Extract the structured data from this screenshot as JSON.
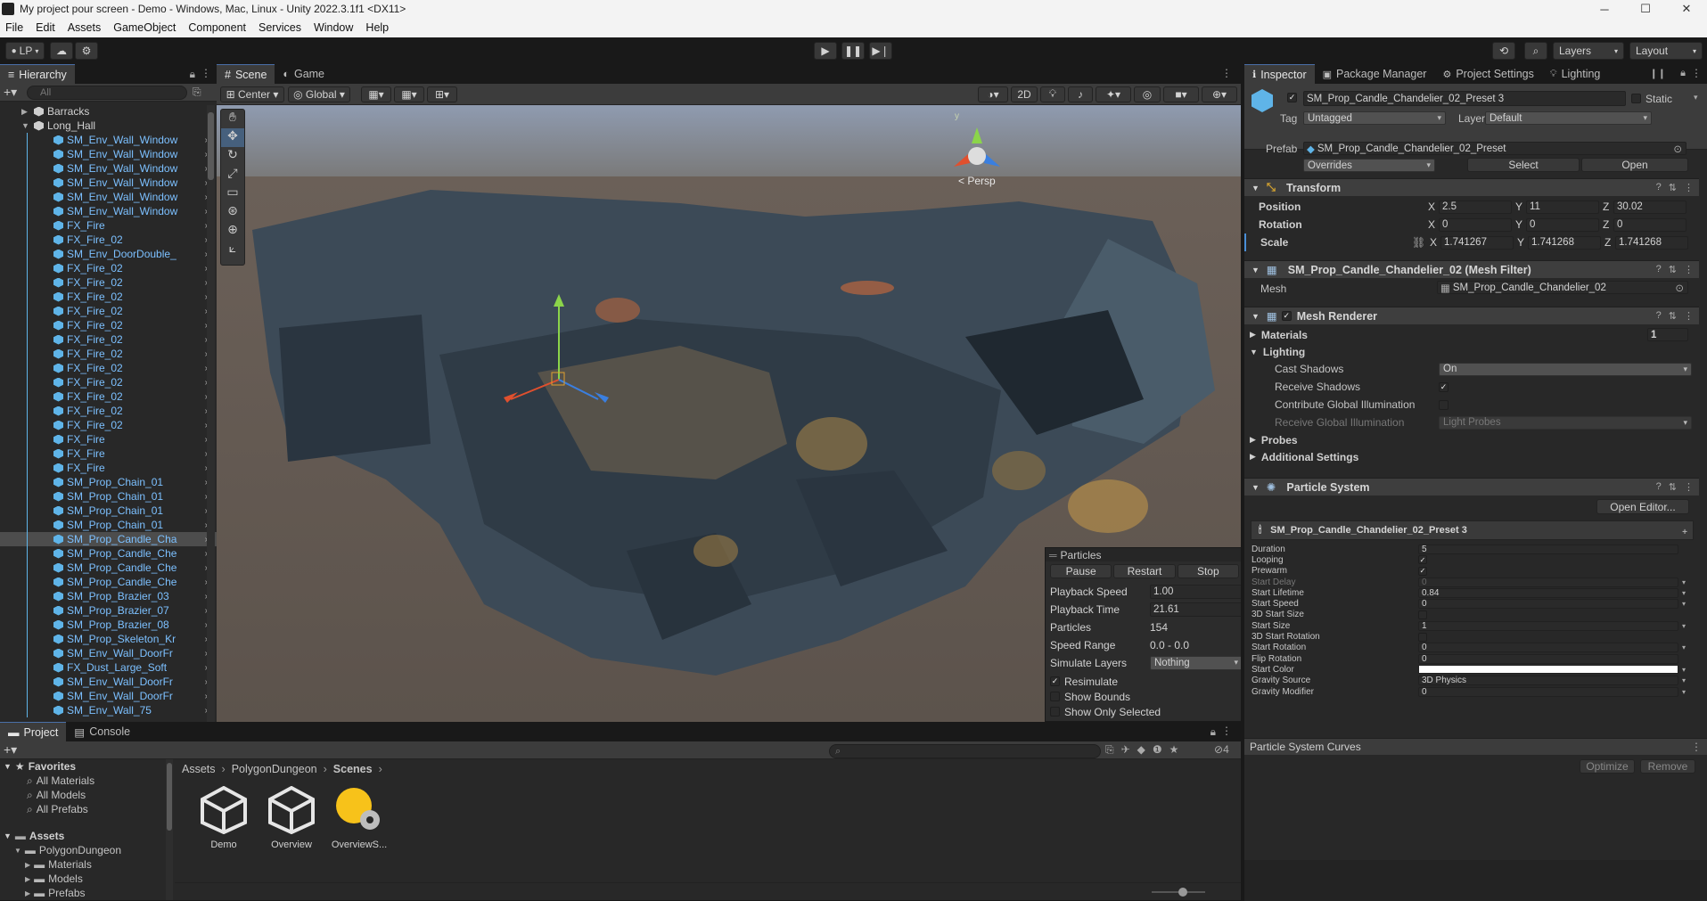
{
  "window": {
    "title": "My project pour screen - Demo - Windows, Mac, Linux - Unity 2022.3.1f1 <DX11>"
  },
  "menu": [
    "File",
    "Edit",
    "Assets",
    "GameObject",
    "Component",
    "Services",
    "Window",
    "Help"
  ],
  "toolbar": {
    "account": "LP",
    "layers": "Layers",
    "layout": "Layout"
  },
  "hierarchy": {
    "tab": "Hierarchy",
    "search_placeholder": "All",
    "items": [
      {
        "label": "Barracks",
        "indent": 0,
        "kind": "root"
      },
      {
        "label": "Long_Hall",
        "indent": 0,
        "kind": "root"
      },
      {
        "label": "SM_Env_Wall_Window",
        "indent": 1,
        "kind": "prefab"
      },
      {
        "label": "SM_Env_Wall_Window",
        "indent": 1,
        "kind": "prefab"
      },
      {
        "label": "SM_Env_Wall_Window",
        "indent": 1,
        "kind": "prefab"
      },
      {
        "label": "SM_Env_Wall_Window",
        "indent": 1,
        "kind": "prefab"
      },
      {
        "label": "SM_Env_Wall_Window",
        "indent": 1,
        "kind": "prefab"
      },
      {
        "label": "SM_Env_Wall_Window",
        "indent": 1,
        "kind": "prefab"
      },
      {
        "label": "FX_Fire",
        "indent": 1,
        "kind": "prefab"
      },
      {
        "label": "FX_Fire_02",
        "indent": 1,
        "kind": "prefab"
      },
      {
        "label": "SM_Env_DoorDouble_",
        "indent": 1,
        "kind": "prefab"
      },
      {
        "label": "FX_Fire_02",
        "indent": 1,
        "kind": "prefab"
      },
      {
        "label": "FX_Fire_02",
        "indent": 1,
        "kind": "prefab"
      },
      {
        "label": "FX_Fire_02",
        "indent": 1,
        "kind": "prefab"
      },
      {
        "label": "FX_Fire_02",
        "indent": 1,
        "kind": "prefab"
      },
      {
        "label": "FX_Fire_02",
        "indent": 1,
        "kind": "prefab"
      },
      {
        "label": "FX_Fire_02",
        "indent": 1,
        "kind": "prefab"
      },
      {
        "label": "FX_Fire_02",
        "indent": 1,
        "kind": "prefab"
      },
      {
        "label": "FX_Fire_02",
        "indent": 1,
        "kind": "prefab"
      },
      {
        "label": "FX_Fire_02",
        "indent": 1,
        "kind": "prefab"
      },
      {
        "label": "FX_Fire_02",
        "indent": 1,
        "kind": "prefab"
      },
      {
        "label": "FX_Fire_02",
        "indent": 1,
        "kind": "prefab"
      },
      {
        "label": "FX_Fire_02",
        "indent": 1,
        "kind": "prefab"
      },
      {
        "label": "FX_Fire",
        "indent": 1,
        "kind": "prefab"
      },
      {
        "label": "FX_Fire",
        "indent": 1,
        "kind": "prefab"
      },
      {
        "label": "FX_Fire",
        "indent": 1,
        "kind": "prefab"
      },
      {
        "label": "SM_Prop_Chain_01",
        "indent": 1,
        "kind": "prefab"
      },
      {
        "label": "SM_Prop_Chain_01",
        "indent": 1,
        "kind": "prefab"
      },
      {
        "label": "SM_Prop_Chain_01",
        "indent": 1,
        "kind": "prefab"
      },
      {
        "label": "SM_Prop_Chain_01",
        "indent": 1,
        "kind": "prefab"
      },
      {
        "label": "SM_Prop_Candle_Cha",
        "indent": 1,
        "kind": "prefab",
        "selected": true
      },
      {
        "label": "SM_Prop_Candle_Che",
        "indent": 1,
        "kind": "prefab"
      },
      {
        "label": "SM_Prop_Candle_Che",
        "indent": 1,
        "kind": "prefab"
      },
      {
        "label": "SM_Prop_Candle_Che",
        "indent": 1,
        "kind": "prefab"
      },
      {
        "label": "SM_Prop_Brazier_03",
        "indent": 1,
        "kind": "prefab"
      },
      {
        "label": "SM_Prop_Brazier_07",
        "indent": 1,
        "kind": "prefab"
      },
      {
        "label": "SM_Prop_Brazier_08",
        "indent": 1,
        "kind": "prefab"
      },
      {
        "label": "SM_Prop_Skeleton_Kr",
        "indent": 1,
        "kind": "prefab"
      },
      {
        "label": "SM_Env_Wall_DoorFr",
        "indent": 1,
        "kind": "prefab"
      },
      {
        "label": "FX_Dust_Large_Soft",
        "indent": 1,
        "kind": "prefab"
      },
      {
        "label": "SM_Env_Wall_DoorFr",
        "indent": 1,
        "kind": "prefab"
      },
      {
        "label": "SM_Env_Wall_DoorFr",
        "indent": 1,
        "kind": "prefab"
      },
      {
        "label": "SM_Env_Wall_75",
        "indent": 1,
        "kind": "prefab"
      }
    ]
  },
  "scene": {
    "tabs": [
      "Scene",
      "Game"
    ],
    "pivot": "Center",
    "space": "Global",
    "mode2d": "2D",
    "persp": "< Persp",
    "particles": {
      "title": "Particles",
      "buttons": [
        "Pause",
        "Restart",
        "Stop"
      ],
      "rows": [
        {
          "label": "Playback Speed",
          "value": "1.00",
          "field": true
        },
        {
          "label": "Playback Time",
          "value": "21.61",
          "field": true
        },
        {
          "label": "Particles",
          "value": "154",
          "field": false
        },
        {
          "label": "Speed Range",
          "value": "0.0 - 0.0",
          "field": false
        }
      ],
      "simulate_layers_label": "Simulate Layers",
      "simulate_layers_value": "Nothing",
      "toggles": [
        {
          "label": "Resimulate",
          "checked": true
        },
        {
          "label": "Show Bounds",
          "checked": false
        },
        {
          "label": "Show Only Selected",
          "checked": false
        }
      ]
    }
  },
  "inspector": {
    "tabs": [
      "Inspector",
      "Package Manager",
      "Project Settings",
      "Lighting"
    ],
    "object_name": "SM_Prop_Candle_Chandelier_02_Preset 3",
    "static_label": "Static",
    "tag_label": "Tag",
    "tag_value": "Untagged",
    "layer_label": "Layer",
    "layer_value": "Default",
    "prefab_label": "Prefab",
    "prefab_value": "SM_Prop_Candle_Chandelier_02_Preset",
    "overrides": "Overrides",
    "select": "Select",
    "open": "Open",
    "transform": {
      "title": "Transform",
      "position": {
        "label": "Position",
        "x": "2.5",
        "y": "11",
        "z": "30.02"
      },
      "rotation": {
        "label": "Rotation",
        "x": "0",
        "y": "0",
        "z": "0"
      },
      "scale": {
        "label": "Scale",
        "x": "1.741267",
        "y": "1.741268",
        "z": "1.741268"
      }
    },
    "mesh_filter": {
      "title": "SM_Prop_Candle_Chandelier_02 (Mesh Filter)",
      "mesh_label": "Mesh",
      "mesh_value": "SM_Prop_Candle_Chandelier_02"
    },
    "mesh_renderer": {
      "title": "Mesh Renderer",
      "materials": "Materials",
      "materials_count": "1",
      "lighting": "Lighting",
      "cast_shadows_label": "Cast Shadows",
      "cast_shadows_value": "On",
      "receive_shadows_label": "Receive Shadows",
      "contribute_gi_label": "Contribute Global Illumination",
      "receive_gi_label": "Receive Global Illumination",
      "receive_gi_value": "Light Probes",
      "probes": "Probes",
      "additional": "Additional Settings"
    },
    "particle_system": {
      "title": "Particle System",
      "open_editor": "Open Editor...",
      "preset_name": "SM_Prop_Candle_Chandelier_02_Preset 3",
      "rows": [
        {
          "label": "Duration",
          "value": "5",
          "type": "field"
        },
        {
          "label": "Looping",
          "value": "",
          "type": "check",
          "checked": true
        },
        {
          "label": "Prewarm",
          "value": "",
          "type": "check",
          "checked": true
        },
        {
          "label": "Start Delay",
          "value": "0",
          "type": "dd",
          "dim": true
        },
        {
          "label": "Start Lifetime",
          "value": "0.84",
          "type": "dd"
        },
        {
          "label": "Start Speed",
          "value": "0",
          "type": "dd"
        },
        {
          "label": "3D Start Size",
          "value": "",
          "type": "check",
          "checked": false
        },
        {
          "label": "Start Size",
          "value": "1",
          "type": "dd"
        },
        {
          "label": "3D Start Rotation",
          "value": "",
          "type": "check",
          "checked": false
        },
        {
          "label": "Start Rotation",
          "value": "0",
          "type": "dd"
        },
        {
          "label": "Flip Rotation",
          "value": "0",
          "type": "field"
        },
        {
          "label": "Start Color",
          "value": "",
          "type": "color"
        },
        {
          "label": "Gravity Source",
          "value": "3D Physics",
          "type": "dd"
        },
        {
          "label": "Gravity Modifier",
          "value": "0",
          "type": "dd"
        }
      ]
    },
    "curves": {
      "title": "Particle System Curves",
      "optimize": "Optimize",
      "remove": "Remove"
    }
  },
  "project": {
    "tabs": [
      "Project",
      "Console"
    ],
    "favorites_title": "Favorites",
    "favorites": [
      "All Materials",
      "All Models",
      "All Prefabs"
    ],
    "assets_title": "Assets",
    "tree": [
      {
        "label": "PolygonDungeon",
        "depth": 1,
        "open": true
      },
      {
        "label": "Materials",
        "depth": 2
      },
      {
        "label": "Models",
        "depth": 2
      },
      {
        "label": "Prefabs",
        "depth": 2
      }
    ],
    "breadcrumb": [
      "Assets",
      "PolygonDungeon",
      "Scenes"
    ],
    "hidden_count": "4",
    "files": [
      {
        "label": "Demo",
        "kind": "unity"
      },
      {
        "label": "Overview",
        "kind": "unity"
      },
      {
        "label": "OverviewS...",
        "kind": "lighting"
      }
    ]
  }
}
